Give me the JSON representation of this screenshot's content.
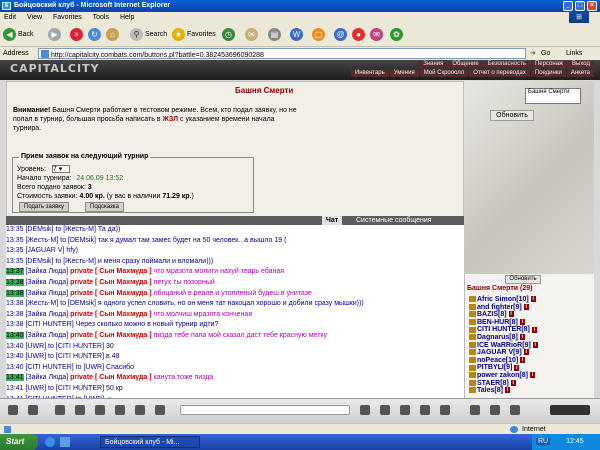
{
  "window": {
    "title": "Бойцовский клуб - Microsoft Internet Explorer",
    "controls": [
      "_",
      "□",
      "×"
    ]
  },
  "menu": [
    "Edit",
    "View",
    "Favorites",
    "Tools",
    "Help"
  ],
  "toolbar": {
    "back_label": "Back",
    "search_label": "Search",
    "favorites_label": "Favorites"
  },
  "address": {
    "label": "Address",
    "url": "http://capitalcity.combats.com/buttons.pl?battle=0.382453696090288",
    "go_label": "Go",
    "links_label": "Links"
  },
  "site": {
    "logo": "CAPITALCITY",
    "nav_top": [
      "Знания",
      "Общение",
      "Безопасность",
      "Персонаж",
      "Выход"
    ],
    "nav_bottom": [
      "Инвентарь",
      "Умения",
      "Мой Скрооолл",
      "Отчет о переводах",
      "Поединки",
      "Анкета"
    ]
  },
  "tower": {
    "title": "Башня Смерти",
    "notice_bold": "Внимание!",
    "notice_text": " Башня Смерти работает в тестовом режиме. Всем, кто подал заявку, но не попал в турнир, большая просьба написать в ",
    "notice_link": "ЖЗЛ",
    "notice_tail": " с указанием времени начала турнира.",
    "form_legend": "Прием заявок на следующий турнир",
    "level_label": "Уровень:",
    "level_value": "7",
    "start_label": "Начало турнира:",
    "start_value": "24.06.09 13:52",
    "total_label": "Всего подано заявок:",
    "total_value": "3",
    "cost_label": "Стоимость заявки:",
    "cost_value": "4.00 кр.",
    "cost_have_label": "(у вас в наличии",
    "cost_have_value": "71.29 кр.",
    "cost_close": ")",
    "submit_label": "Подать заявку",
    "hint_label": "Подсказка",
    "refresh_label": "Обновить",
    "mini_list_item": "Башня Смерти"
  },
  "chat_tabs": {
    "chat": "Чат",
    "system": "Системные сообщения"
  },
  "chat": [
    {
      "time": "13:35",
      "green": false,
      "from": "[DEMsik]",
      "to": "to [Жесть-М]",
      "private": "",
      "text": "Та да))"
    },
    {
      "time": "13:35",
      "green": false,
      "from": "[Жесть-М]",
      "to": "to [DEMsik]",
      "private": "",
      "text": "так я думал там замес будет на 50 человек.. а вышло 19 ("
    },
    {
      "time": "13:35",
      "green": false,
      "from": "[JAGUAR V]",
      "to": "",
      "private": "",
      "text": "hfy)"
    },
    {
      "time": "13:35",
      "green": false,
      "from": "[DEMsik]",
      "to": "to [Жесть-М]",
      "private": "",
      "text": "и меня сразу поймали и вломали)))"
    },
    {
      "time": "13:37",
      "green": true,
      "from": "[Зайка Люда]",
      "to": "",
      "private": "private [ Сын Махмуда ]",
      "text": "что мразота молити нахуй тварь ебаная"
    },
    {
      "time": "13:38",
      "green": true,
      "from": "[Зайка Люда]",
      "to": "",
      "private": "private [ Сын Махмуда ]",
      "text": "петух ты позорный"
    },
    {
      "time": "13:38",
      "green": true,
      "from": "[Зайка Люда]",
      "to": "",
      "private": "private [ Сын Махмуда ]",
      "text": "обоцаный в реале и утопленый будеш в унитазе"
    },
    {
      "time": "13:38",
      "green": false,
      "from": "[Жесть-М]",
      "to": "to [DEMsik]",
      "private": "",
      "text": "я одного успел словить, но он меня тат накоцал хорошо и добили сразу мышки)))"
    },
    {
      "time": "13:38",
      "green": false,
      "from": "[Зайка Люда]",
      "to": "",
      "private": "private [ Сын Махмуда ]",
      "text": "что молчиш мразота конченая"
    },
    {
      "time": "13:38",
      "green": false,
      "from": "[CITI HUNTER]",
      "to": "",
      "private": "",
      "text": "Через сколько можно в новый турнир идти?"
    },
    {
      "time": "13:40",
      "green": true,
      "from": "[Зайка Люда]",
      "to": "",
      "private": "private [ Сын Махмуда ]",
      "text": "пизда тебе папа мой сказал даст тебе красную метку"
    },
    {
      "time": "13:40",
      "green": false,
      "from": "[UWR]",
      "to": "to [CITI HUNTER]",
      "private": "",
      "text": "30"
    },
    {
      "time": "13:40",
      "green": false,
      "from": "[UWR]",
      "to": "to [CITI HUNTER]",
      "private": "",
      "text": "в 48"
    },
    {
      "time": "13:40",
      "green": false,
      "from": "[CITI HUNTER]",
      "to": "to [UWR]",
      "private": "",
      "text": "Спасибо"
    },
    {
      "time": "13:41",
      "green": true,
      "from": "[Зайка Люда]",
      "to": "",
      "private": "private [ Сын Махмуда ]",
      "text": "канута тоже пизда"
    },
    {
      "time": "13:41",
      "green": false,
      "from": "[UWR]",
      "to": "to [CITI HUNTER]",
      "private": "",
      "text": "50 кр"
    },
    {
      "time": "13:41",
      "green": false,
      "from": "[CITI HUNTER]",
      "to": "to [UWR]",
      "private": "",
      "text": "☺"
    },
    {
      "time": "13:41",
      "green": false,
      "from": "[UWR]",
      "to": "to [CITI HUNTER]",
      "private": "",
      "text": "☺"
    }
  ],
  "users": {
    "refresh_label": "Обновить",
    "header": "Башня Смерти (29)",
    "list": [
      "Afric Simon[10]",
      "and fighter[9]",
      "BAZIS[8]",
      "BEN-HUR[8]",
      "CITI HUNTER[8]",
      "Dagnarus[8]",
      "ICE WaRRioR[9]",
      "JAGUAR V[9]",
      "noPeace[10]",
      "PITBYLI[9]",
      "power zakon[8]",
      "STAER[8]",
      "Tales[8]"
    ]
  },
  "status": {
    "right": "Internet"
  },
  "taskbar": {
    "start": "Start",
    "task": "Бойцовский клуб - Mi...",
    "lang": "RU",
    "clock": "12:45"
  }
}
